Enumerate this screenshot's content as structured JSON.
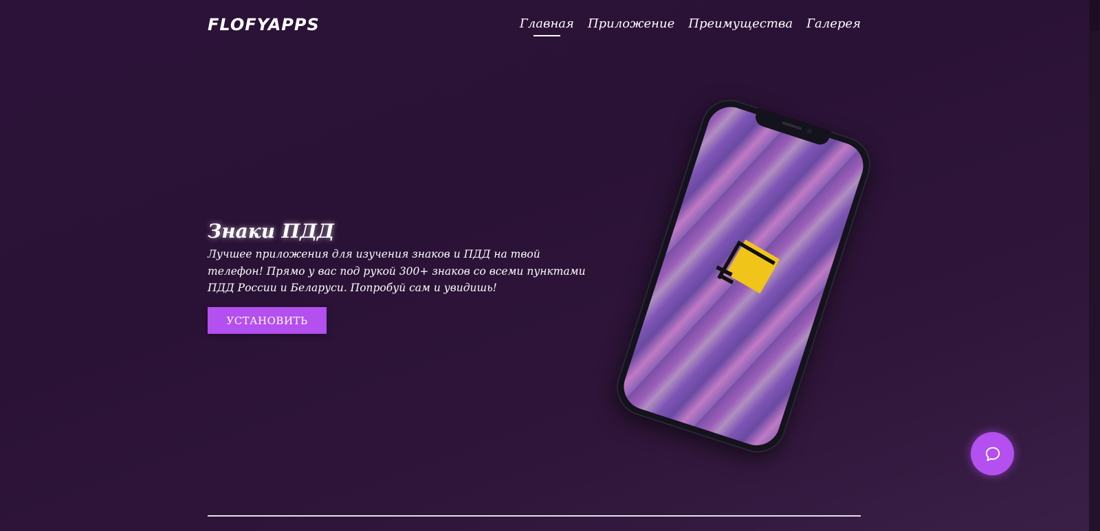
{
  "header": {
    "logo": "FLOFYAPPS",
    "nav": [
      {
        "label": "Главная",
        "active": true
      },
      {
        "label": "Приложение",
        "active": false
      },
      {
        "label": "Преимущества",
        "active": false
      },
      {
        "label": "Галерея",
        "active": false
      }
    ]
  },
  "hero": {
    "title": "Знаки ПДД",
    "description": "Лучшее приложения для изучения знаков и ПДД на твой телефон! Прямо у вас под рукой 300+ знаков со всеми пунктами ПДД России и Беларуси. Попробуй сам и увидишь!",
    "install_label": "УСТАНОВИТЬ"
  },
  "chat": {
    "icon": "chat-bubble-icon"
  },
  "colors": {
    "accent": "#b44ff0",
    "background": "#2c1238",
    "app_icon": "#f0c419"
  }
}
